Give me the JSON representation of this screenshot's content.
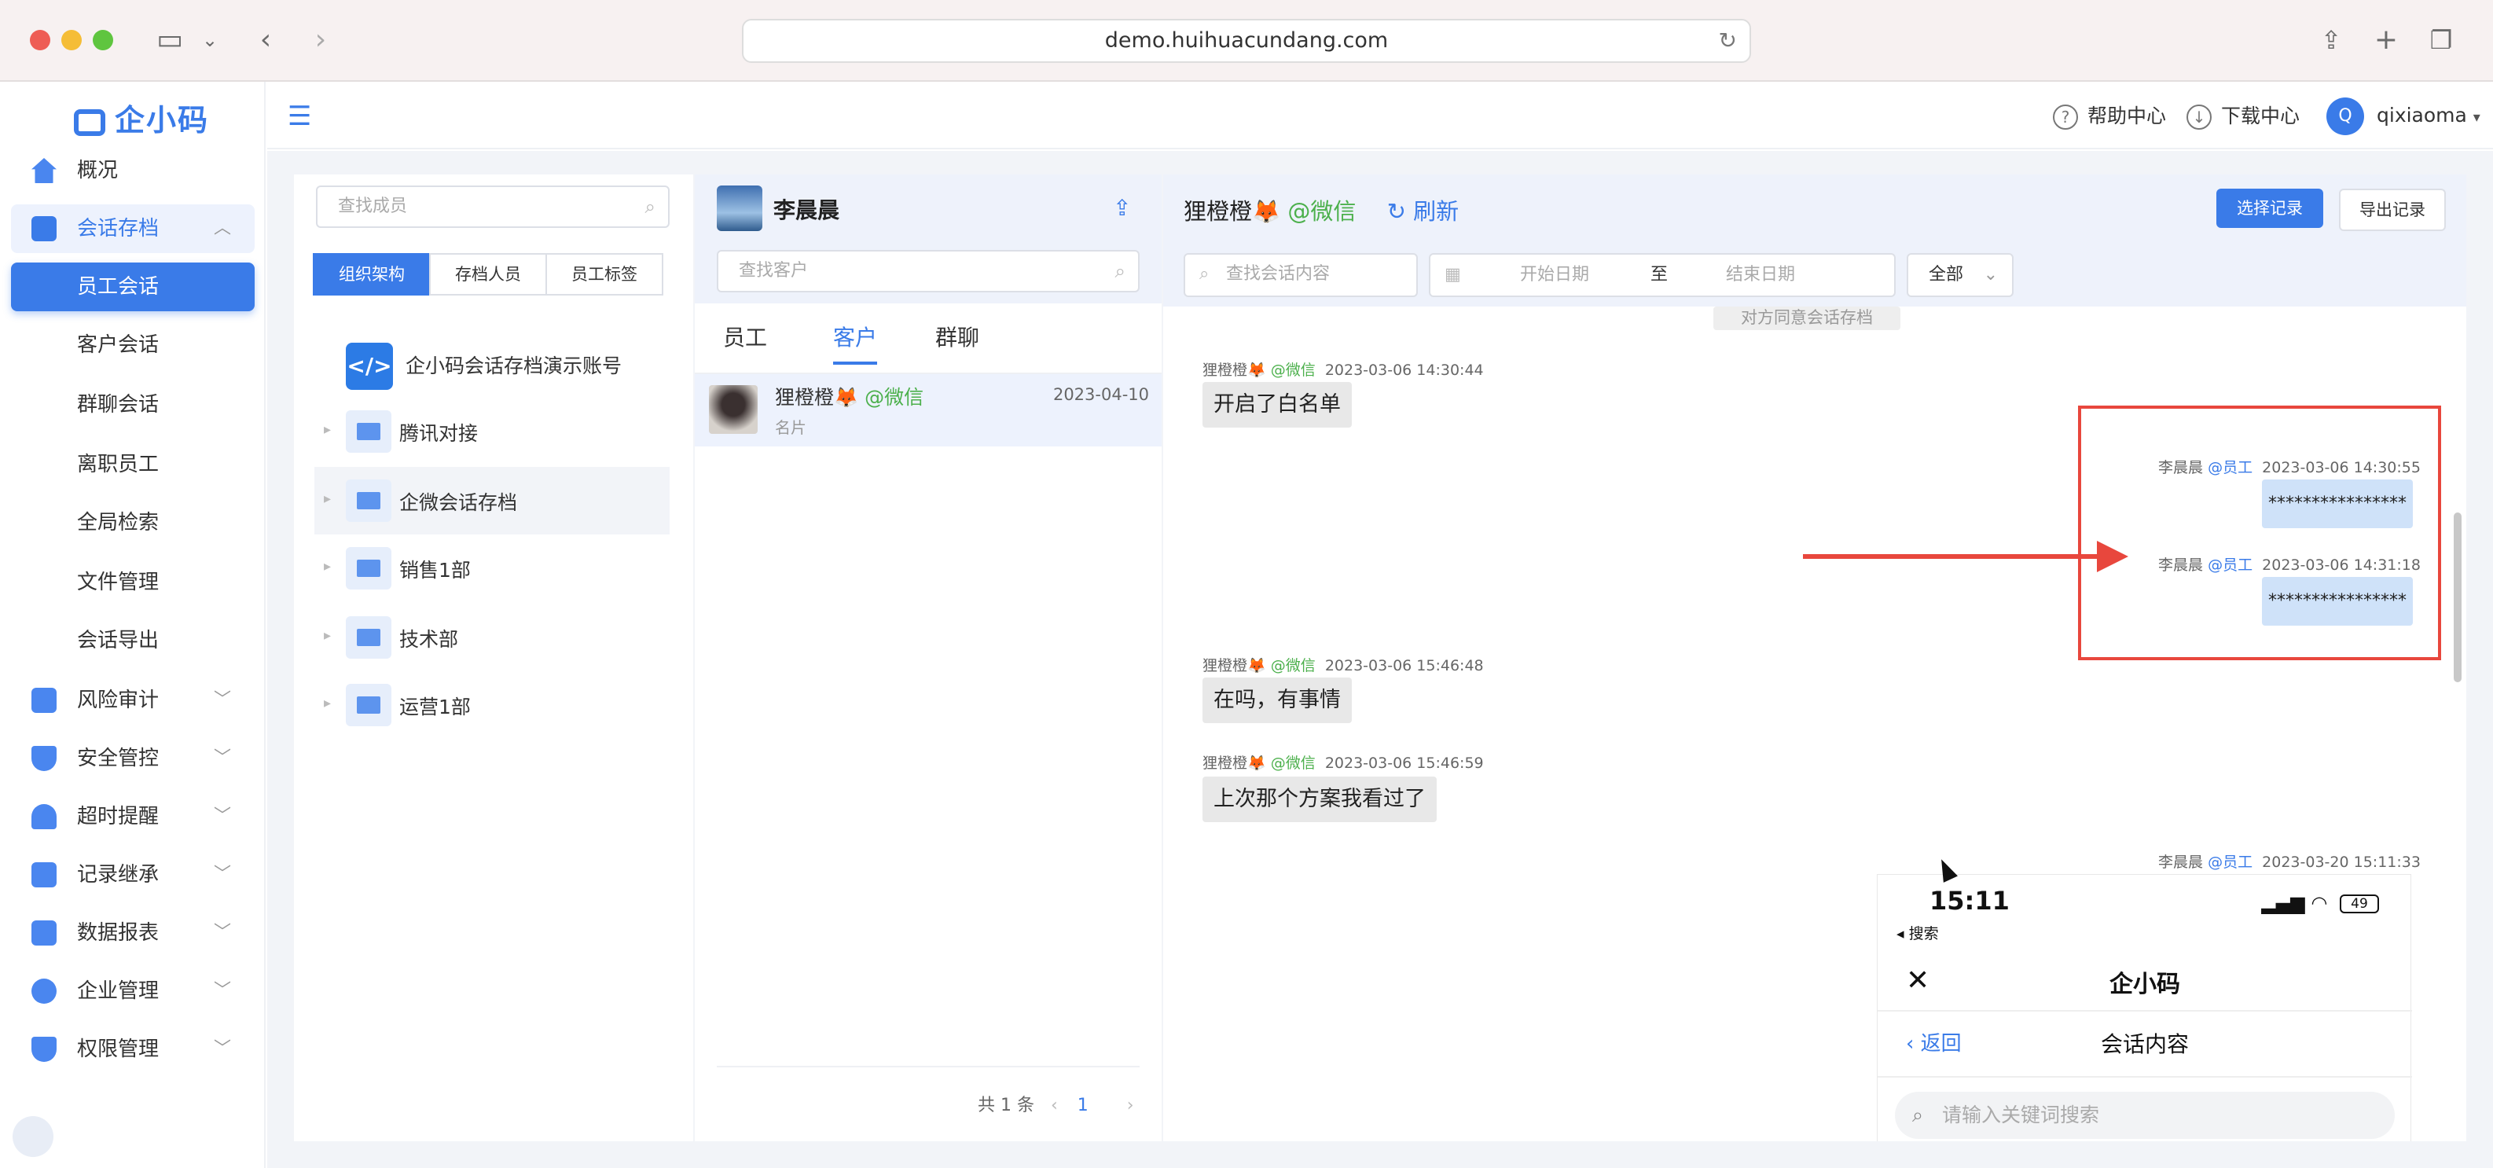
{
  "browser": {
    "url": "demo.huihuacundang.com"
  },
  "brand": {
    "logo_text": "企小码"
  },
  "sidebar": {
    "items": [
      {
        "label": "概况",
        "icon": "home-icon"
      },
      {
        "label": "会话存档",
        "icon": "archive-icon"
      },
      {
        "label": "风险审计",
        "icon": "audit-icon"
      },
      {
        "label": "安全管控",
        "icon": "shield-icon"
      },
      {
        "label": "超时提醒",
        "icon": "bell-icon"
      },
      {
        "label": "记录继承",
        "icon": "inherit-icon"
      },
      {
        "label": "数据报表",
        "icon": "chart-icon"
      },
      {
        "label": "企业管理",
        "icon": "company-icon"
      },
      {
        "label": "权限管理",
        "icon": "lock-icon"
      }
    ],
    "sub_items": [
      "员工会话",
      "客户会话",
      "群聊会话",
      "离职员工",
      "全局检索",
      "文件管理",
      "会话导出"
    ]
  },
  "topbar": {
    "help": "帮助中心",
    "download": "下载中心",
    "avatar_letter": "Q",
    "username": "qixiaoma"
  },
  "members_panel": {
    "search_placeholder": "查找成员",
    "tabs": [
      "组织架构",
      "存档人员",
      "员工标签"
    ],
    "root_label": "企小码会话存档演示账号",
    "departments": [
      "腾讯对接",
      "企微会话存档",
      "销售1部",
      "技术部",
      "运营1部"
    ]
  },
  "contacts_panel": {
    "employee_name": "李晨晨",
    "search_placeholder": "查找客户",
    "tabs": [
      "员工",
      "客户",
      "群聊"
    ],
    "items": [
      {
        "name": "狸橙橙🦊",
        "tag": "@微信",
        "date": "2023-04-10",
        "sub": "名片"
      }
    ],
    "pagination": {
      "total": "共 1 条",
      "current": "1"
    }
  },
  "chat_panel": {
    "title": "狸橙橙🦊",
    "title_tag": "@微信",
    "refresh": "刷新",
    "select_button": "选择记录",
    "export_button": "导出记录",
    "search_placeholder": "查找会话内容",
    "start_date": "开始日期",
    "date_sep": "至",
    "end_date": "结束日期",
    "filter": "全部",
    "notice": "对方同意会话存档",
    "messages": [
      {
        "sender": "狸橙橙🦊",
        "tag": "@微信",
        "time": "2023-03-06 14:30:44",
        "text": "开启了白名单"
      },
      {
        "sender": "李晨晨",
        "tag": "@员工",
        "time": "2023-03-06 14:30:55",
        "text": "****************"
      },
      {
        "sender": "李晨晨",
        "tag": "@员工",
        "time": "2023-03-06 14:31:18",
        "text": "****************"
      },
      {
        "sender": "狸橙橙🦊",
        "tag": "@微信",
        "time": "2023-03-06 15:46:48",
        "text": "在吗，有事情"
      },
      {
        "sender": "狸橙橙🦊",
        "tag": "@微信",
        "time": "2023-03-06 15:46:59",
        "text": "上次那个方案我看过了"
      },
      {
        "sender": "李晨晨",
        "tag": "@员工",
        "time": "2023-03-20 15:11:33",
        "text": ""
      }
    ]
  },
  "phone_shot": {
    "time": "15:11",
    "back_search": "◂ 搜索",
    "battery": "49",
    "title": "企小码",
    "back": "返回",
    "subtitle": "会话内容",
    "search_placeholder": "请输入关键词搜索"
  },
  "colors": {
    "accent": "#3a7be8",
    "wechat_tag": "#4cb04c",
    "highlight": "#e8473d"
  }
}
